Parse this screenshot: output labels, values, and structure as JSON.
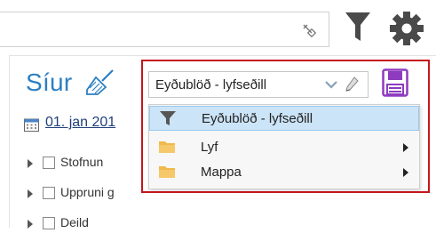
{
  "search": {
    "value": "",
    "placeholder": ""
  },
  "toolbar": {
    "filter_icon": "funnel-icon",
    "settings_icon": "gear-icon"
  },
  "panel": {
    "title": "Síur",
    "clear_icon": "broom-icon",
    "date": "01. jan 201",
    "tree": [
      {
        "label": "Stofnun"
      },
      {
        "label": "Uppruni g"
      },
      {
        "label": "Deild"
      }
    ]
  },
  "filter_select": {
    "value": "Eyðublöð - lyfseðill"
  },
  "menu": {
    "items": [
      {
        "label": "Eyðublöð - lyfseðill",
        "icon": "funnel-icon",
        "submenu": false,
        "selected": true
      },
      {
        "label": "Lyf",
        "icon": "folder-icon",
        "submenu": true,
        "selected": false
      },
      {
        "label": "Mappa",
        "icon": "folder-icon",
        "submenu": true,
        "selected": false
      }
    ]
  },
  "colors": {
    "accent": "#2c7fc3",
    "highlight_border": "#c4161c",
    "save_icon": "#8e3bbf",
    "folder": "#f2b94a",
    "selected_row": "#cce4f7"
  }
}
